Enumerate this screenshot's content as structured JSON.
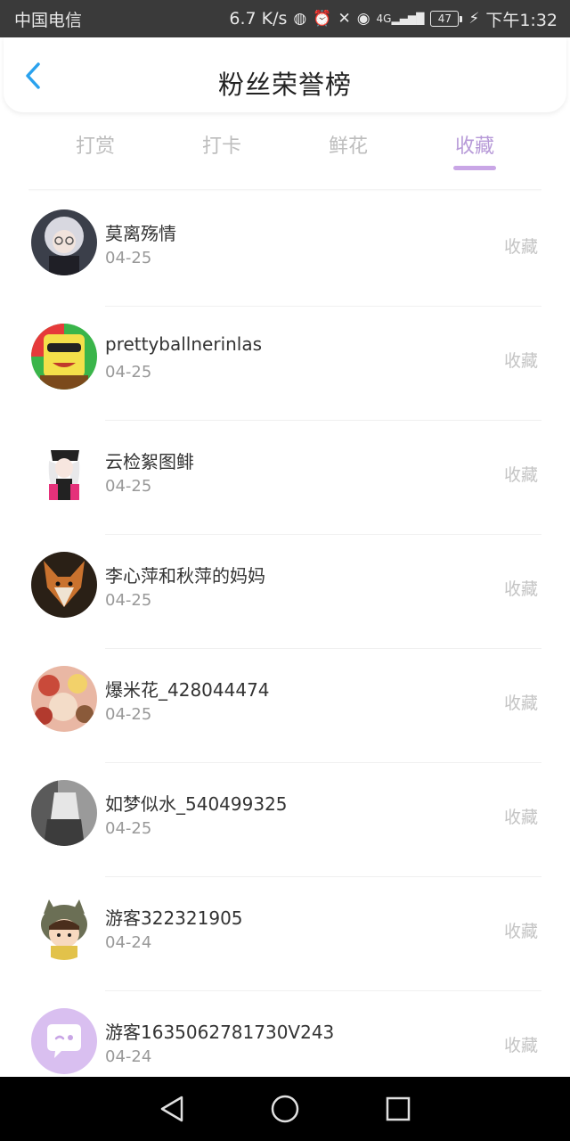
{
  "status_bar": {
    "carrier": "中国电信",
    "speed": "6.7 K/s",
    "network": "4G",
    "battery": "47",
    "time": "下午1:32"
  },
  "header": {
    "title": "粉丝荣誉榜"
  },
  "tabs": [
    {
      "label": "打赏",
      "active": false
    },
    {
      "label": "打卡",
      "active": false
    },
    {
      "label": "鲜花",
      "active": false
    },
    {
      "label": "收藏",
      "active": true
    }
  ],
  "colors": {
    "accent": "#b79ad8",
    "underline": "#c9a6e6",
    "status_bar_bg": "#3a3a3a",
    "nav_bar_bg": "#000000"
  },
  "fans": [
    {
      "name": "莫离殇情",
      "date": "04-25",
      "action": "收藏",
      "avatar": "gothic-girl-avatar"
    },
    {
      "name": "prettyballnerinlas",
      "date": "04-25",
      "action": "收藏",
      "avatar": "cartoon-sponge-avatar"
    },
    {
      "name": "云检絮图鲱",
      "date": "04-25",
      "action": "收藏",
      "avatar": "anime-girl-avatar"
    },
    {
      "name": "李心萍和秋萍的妈妈",
      "date": "04-25",
      "action": "收藏",
      "avatar": "fox-avatar"
    },
    {
      "name": "爆米花_428044474",
      "date": "04-25",
      "action": "收藏",
      "avatar": "illustration-avatar"
    },
    {
      "name": "如梦似水_540499325",
      "date": "04-25",
      "action": "收藏",
      "avatar": "sketch-girl-avatar"
    },
    {
      "name": "游客322321905",
      "date": "04-24",
      "action": "收藏",
      "avatar": "totoro-kid-avatar"
    },
    {
      "name": "游客1635062781730V243",
      "date": "04-24",
      "action": "收藏",
      "avatar": "default-chat-avatar"
    }
  ]
}
